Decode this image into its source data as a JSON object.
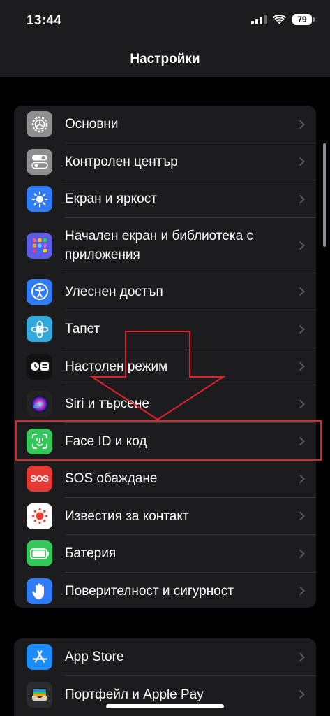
{
  "status": {
    "time": "13:44",
    "battery": "79"
  },
  "nav": {
    "title": "Настройки"
  },
  "settings": {
    "group1": [
      {
        "label": "Основни",
        "icon": "gear-icon",
        "color": "#8e8e93"
      },
      {
        "label": "Контролен център",
        "icon": "toggles-icon",
        "color": "#8e8e93"
      },
      {
        "label": "Екран и яркост",
        "icon": "sun-icon",
        "color": "#2f7cf6"
      },
      {
        "label": "Начален екран и библиотека с приложения",
        "icon": "app-grid-icon",
        "color": "#5e5ce6"
      },
      {
        "label": "Улеснен достъп",
        "icon": "accessibility-icon",
        "color": "#2f7cf6"
      },
      {
        "label": "Тапет",
        "icon": "flower-icon",
        "color": "#34aadc"
      },
      {
        "label": "Настолен режим",
        "icon": "standby-icon",
        "color": "#111111"
      },
      {
        "label": "Siri и търсене",
        "icon": "siri-icon",
        "color": "#222222"
      },
      {
        "label": "Face ID и код",
        "icon": "face-id-icon",
        "color": "#34c759"
      },
      {
        "label": "SOS обаждане",
        "icon": "sos-icon",
        "color": "#e53935",
        "icon_text": "SOS"
      },
      {
        "label": "Известия за контакт",
        "icon": "exposure-icon",
        "color": "#ffffff"
      },
      {
        "label": "Батерия",
        "icon": "battery-icon",
        "color": "#34c759"
      },
      {
        "label": "Поверителност и сигурност",
        "icon": "hand-icon",
        "color": "#2f7cf6"
      }
    ],
    "group2": [
      {
        "label": "App Store",
        "icon": "app-store-icon",
        "color": "#1e8cf8"
      },
      {
        "label": "Портфейл и Apple Pay",
        "icon": "wallet-icon",
        "color": "#2c2c2e"
      }
    ]
  },
  "annotations": {
    "highlight_color": "#e0222a"
  }
}
